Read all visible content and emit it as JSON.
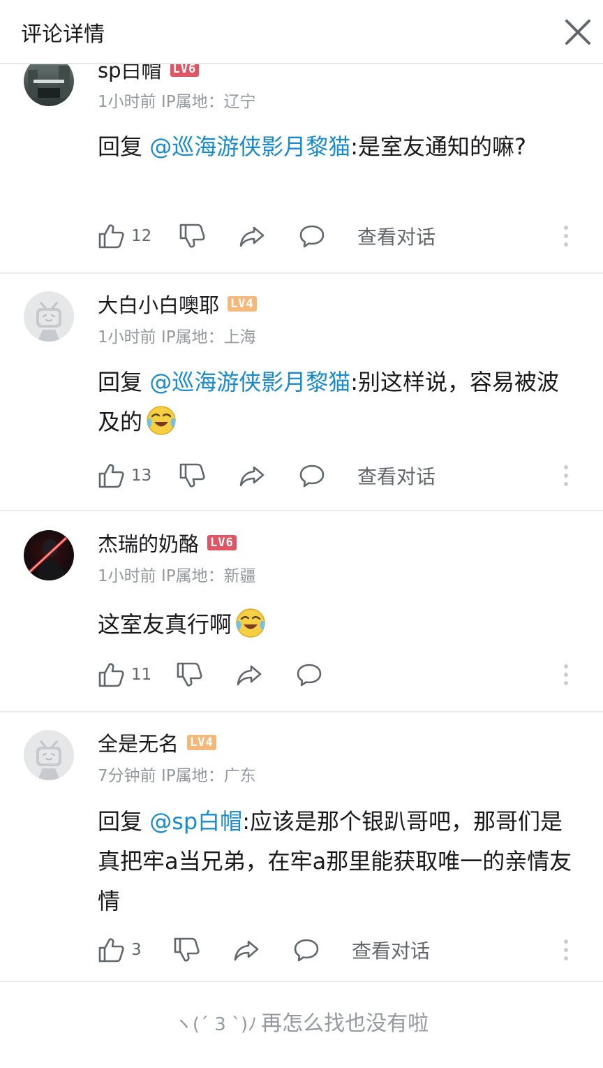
{
  "header": {
    "title": "评论详情",
    "close_icon": "close-icon"
  },
  "colors": {
    "link": "#178bcf",
    "meta": "#9499a0",
    "badge_red": "#e05563",
    "badge_orange": "#f3b97a"
  },
  "comments": [
    {
      "username": "sp白帽",
      "level": "LV6",
      "time": "1小时前",
      "ip_location": "IP属地：辽宁",
      "reply_prefix": "回复 ",
      "reply_to": "@巡海游侠影月黎猫",
      "text": ":是室友通知的嘛?",
      "likes": "12",
      "view_dialog": "查看对话"
    },
    {
      "username": "大白小白噢耶",
      "level": "LV4",
      "time": "1小时前",
      "ip_location": "IP属地：上海",
      "reply_prefix": "回复 ",
      "reply_to": "@巡海游侠影月黎猫",
      "text": ":别这样说，容易被波及的",
      "emoji": "laugh-cry-emoji",
      "likes": "13",
      "view_dialog": "查看对话"
    },
    {
      "username": "杰瑞的奶酪",
      "level": "LV6",
      "time": "1小时前",
      "ip_location": "IP属地：新疆",
      "text": "这室友真行啊",
      "emoji": "laugh-cry-emoji",
      "likes": "11"
    },
    {
      "username": "全是无名",
      "level": "LV4",
      "time": "7分钟前",
      "ip_location": "IP属地：广东",
      "reply_prefix": "回复 ",
      "reply_to": "@sp白帽",
      "text": ":应该是那个银趴哥吧，那哥们是真把牢a当兄弟，在牢a那里能获取唯一的亲情友情",
      "likes": "3",
      "view_dialog": "查看对话"
    }
  ],
  "footer": {
    "kaomoji": "ヽ(ˊ 3 ˋ)ﾉ",
    "text": "再怎么找也没有啦"
  }
}
